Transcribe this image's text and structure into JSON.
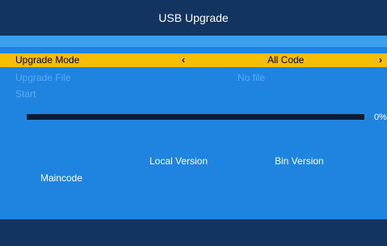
{
  "header": {
    "title": "USB Upgrade"
  },
  "menu": {
    "upgrade_mode": {
      "label": "Upgrade Mode",
      "value": "All Code",
      "left_arrow": "‹",
      "right_arrow": "›"
    },
    "upgrade_file": {
      "label": "Upgrade File",
      "value": "No file"
    },
    "start": {
      "label": "Start"
    }
  },
  "progress": {
    "percent_text": "0%",
    "value": 0
  },
  "versions": {
    "local_header": "Local Version",
    "bin_header": "Bin Version",
    "rows": [
      {
        "label": "Maincode"
      }
    ]
  },
  "colors": {
    "background": "#1f84e0",
    "header_bar": "#13345f",
    "highlight": "#f6be00",
    "disabled_text": "#5aaaf0"
  }
}
